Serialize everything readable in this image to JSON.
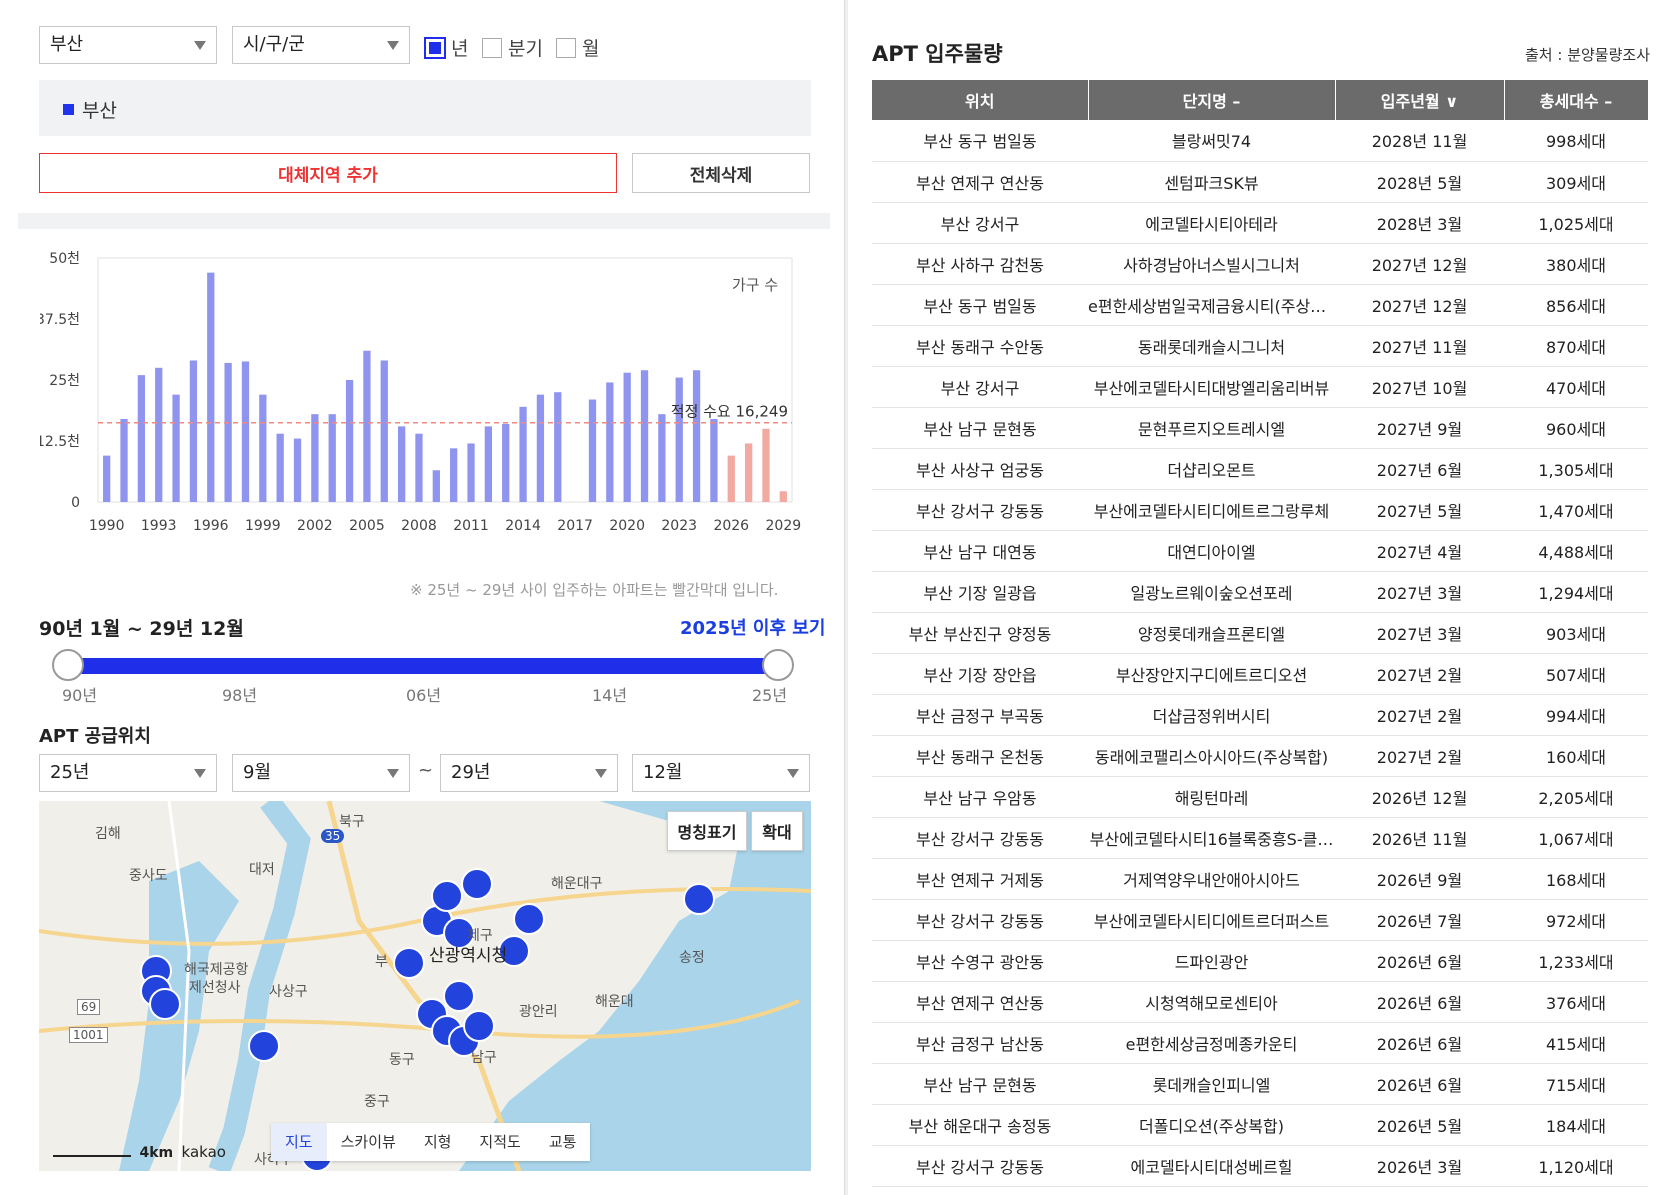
{
  "filters": {
    "region": "부산",
    "district": "시/구/군",
    "period_options": [
      {
        "label": "년",
        "checked": true
      },
      {
        "label": "분기",
        "checked": false
      },
      {
        "label": "월",
        "checked": false
      }
    ]
  },
  "selected_region": "부산",
  "buttons": {
    "add_region": "대체지역 추가",
    "delete_all": "전체삭제"
  },
  "chart_data": {
    "type": "bar",
    "legend_label": "가구 수",
    "y_ticks": [
      "50천",
      "37.5천",
      "25천",
      "12.5천",
      "0"
    ],
    "ylim": [
      0,
      50000
    ],
    "x_tick_labels": [
      "1990",
      "1993",
      "1996",
      "1999",
      "2002",
      "2005",
      "2008",
      "2011",
      "2014",
      "2017",
      "2020",
      "2023",
      "2026",
      "2029"
    ],
    "x": [
      1990,
      1991,
      1992,
      1993,
      1994,
      1995,
      1996,
      1997,
      1998,
      1999,
      2000,
      2001,
      2002,
      2003,
      2004,
      2005,
      2006,
      2007,
      2008,
      2009,
      2010,
      2011,
      2012,
      2013,
      2014,
      2015,
      2016,
      2017,
      2018,
      2019,
      2020,
      2021,
      2022,
      2023,
      2024,
      2025,
      2026,
      2027,
      2028,
      2029
    ],
    "values": [
      9500,
      17000,
      26000,
      27500,
      22000,
      29000,
      47000,
      28500,
      28800,
      22000,
      14000,
      13000,
      18000,
      18000,
      25000,
      31000,
      29000,
      15500,
      14000,
      6500,
      11000,
      12000,
      15500,
      16000,
      19500,
      22000,
      22500,
      0,
      21000,
      24500,
      26500,
      27000,
      18000,
      25500,
      27000,
      17000,
      9500,
      12000,
      15000,
      2200
    ],
    "highlight_from": 2026,
    "reference_line": {
      "value": 16249,
      "label": "적정 수요 16,249"
    },
    "note": "※ 25년 ~ 29년 사이 입주하는 아파트는 빨간막대 입니다.",
    "colors": {
      "normal": "#8f95ee",
      "highlight": "#f2a9a0",
      "reference": "#f08a80"
    }
  },
  "range": {
    "label": "90년 1월 ~ 29년 12월",
    "link": "2025년 이후 보기",
    "ticks": [
      "90년",
      "98년",
      "06년",
      "14년",
      "25년"
    ]
  },
  "supply_section": {
    "title": "APT 공급위치",
    "from_year": "25년",
    "from_month": "9월",
    "tilde": "~",
    "to_year": "29년",
    "to_month": "12월"
  },
  "map": {
    "btn_names": "명칭표기",
    "btn_zoom": "확대",
    "tabs": [
      "지도",
      "스카이뷰",
      "지형",
      "지적도",
      "교통"
    ],
    "active_tab": "지도",
    "scale": "4km",
    "brand": "kakao",
    "labels": [
      "김해",
      "북구",
      "대저",
      "중사도",
      "해운대구",
      "사상구",
      "산광역시청",
      "해운대",
      "광안리",
      "송정",
      "동구",
      "남구",
      "중구",
      "사하구",
      "69",
      "1001",
      "35",
      "해국제공항",
      "제선청사",
      "제구",
      "부"
    ]
  },
  "table": {
    "title": "APT 입주물량",
    "source": "출처 : 분양물량조사",
    "headers": [
      "위치",
      "단지명 –",
      "입주년월 ∨",
      "총세대수 –"
    ],
    "rows": [
      [
        "부산 동구 범일동",
        "블랑써밋74",
        "2028년 11월",
        "998세대"
      ],
      [
        "부산 연제구 연산동",
        "센텀파크SK뷰",
        "2028년 5월",
        "309세대"
      ],
      [
        "부산 강서구",
        "에코델타시티아테라",
        "2028년 3월",
        "1,025세대"
      ],
      [
        "부산 사하구 감천동",
        "사하경남아너스빌시그니처",
        "2027년 12월",
        "380세대"
      ],
      [
        "부산 동구 범일동",
        "e편한세상범일국제금융시티(주상복…",
        "2027년 12월",
        "856세대"
      ],
      [
        "부산 동래구 수안동",
        "동래롯데캐슬시그니처",
        "2027년 11월",
        "870세대"
      ],
      [
        "부산 강서구",
        "부산에코델타시티대방엘리움리버뷰",
        "2027년 10월",
        "470세대"
      ],
      [
        "부산 남구 문현동",
        "문현푸르지오트레시엘",
        "2027년 9월",
        "960세대"
      ],
      [
        "부산 사상구 엄궁동",
        "더샵리오몬트",
        "2027년 6월",
        "1,305세대"
      ],
      [
        "부산 강서구 강동동",
        "부산에코델타시티디에트르그랑루체",
        "2027년 5월",
        "1,470세대"
      ],
      [
        "부산 남구 대연동",
        "대연디아이엘",
        "2027년 4월",
        "4,488세대"
      ],
      [
        "부산 기장 일광읍",
        "일광노르웨이숲오션포레",
        "2027년 3월",
        "1,294세대"
      ],
      [
        "부산 부산진구 양정동",
        "양정롯데캐슬프론티엘",
        "2027년 3월",
        "903세대"
      ],
      [
        "부산 기장 장안읍",
        "부산장안지구디에트르디오션",
        "2027년 2월",
        "507세대"
      ],
      [
        "부산 금정구 부곡동",
        "더샵금정위버시티",
        "2027년 2월",
        "994세대"
      ],
      [
        "부산 동래구 온천동",
        "동래에코팰리스아시아드(주상복합)",
        "2027년 2월",
        "160세대"
      ],
      [
        "부산 남구 우암동",
        "해링턴마레",
        "2026년 12월",
        "2,205세대"
      ],
      [
        "부산 강서구 강동동",
        "부산에코델타시티16블록중흥S-클…",
        "2026년 11월",
        "1,067세대"
      ],
      [
        "부산 연제구 거제동",
        "거제역양우내안애아시아드",
        "2026년 9월",
        "168세대"
      ],
      [
        "부산 강서구 강동동",
        "부산에코델타시티디에트르더퍼스트",
        "2026년 7월",
        "972세대"
      ],
      [
        "부산 수영구 광안동",
        "드파인광안",
        "2026년 6월",
        "1,233세대"
      ],
      [
        "부산 연제구 연산동",
        "시청역해모로센티아",
        "2026년 6월",
        "376세대"
      ],
      [
        "부산 금정구 남산동",
        "e편한세상금정메종카운티",
        "2026년 6월",
        "415세대"
      ],
      [
        "부산 남구 문현동",
        "롯데캐슬인피니엘",
        "2026년 6월",
        "715세대"
      ],
      [
        "부산 해운대구 송정동",
        "더폴디오션(주상복합)",
        "2026년 5월",
        "184세대"
      ],
      [
        "부산 강서구 강동동",
        "에코델타시티대성베르힐",
        "2026년 3월",
        "1,120세대"
      ]
    ]
  }
}
